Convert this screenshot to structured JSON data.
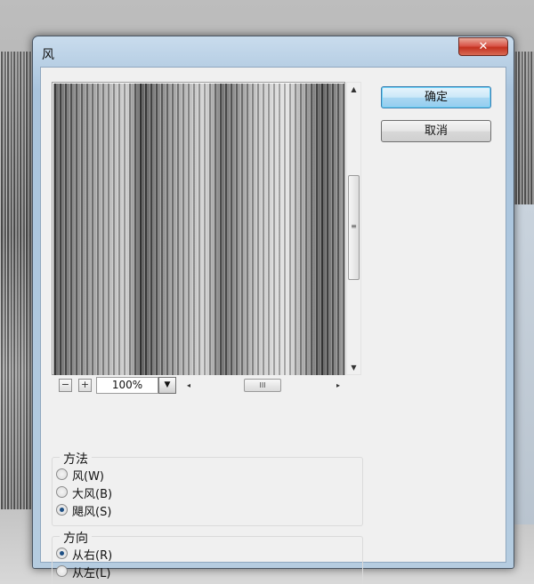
{
  "window": {
    "title": "风",
    "close_glyph": "✕"
  },
  "preview": {
    "zoom_value": "100%",
    "zoom_out_glyph": "−",
    "zoom_in_glyph": "+",
    "dropdown_glyph": "▼",
    "hscroll_left": "◂",
    "hscroll_right": "▸",
    "hscroll_thumb": "III",
    "vscroll_up": "▲",
    "vscroll_down": "▼",
    "vscroll_thumb": "≡"
  },
  "buttons": {
    "ok": "确定",
    "cancel": "取消"
  },
  "method": {
    "legend": "方法",
    "options": [
      {
        "label": "风(W)",
        "checked": false
      },
      {
        "label": "大风(B)",
        "checked": false
      },
      {
        "label": "飓风(S)",
        "checked": true
      }
    ]
  },
  "direction": {
    "legend": "方向",
    "options": [
      {
        "label": "从右(R)",
        "checked": true
      },
      {
        "label": "从左(L)",
        "checked": false
      }
    ]
  }
}
